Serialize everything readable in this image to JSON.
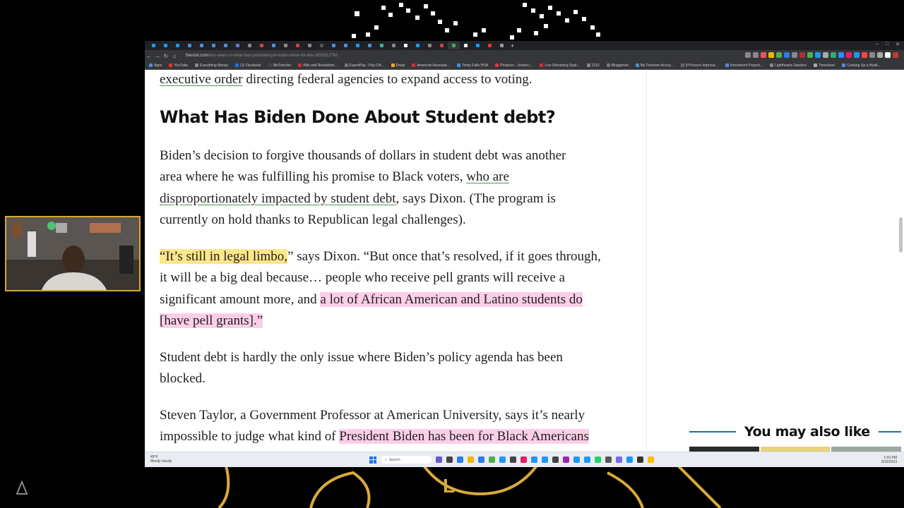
{
  "browser": {
    "tab_count": 30,
    "url_domain": "theroot.com",
    "url_path": "/two-years-in-what-has-president-joe-biden-done-for-bla-1850012763",
    "bookmarks": [
      "Apps",
      "YouTube",
      "Everything Money",
      "(2) Facebook",
      "WeTransfer",
      "Bills and Resolution...",
      "ExpertPay - Pay Chi...",
      "Emoji",
      "American Associati...",
      "Trinity Falls HOA",
      "Products - Jordan l...",
      "Live Streaming Stud...",
      "1215",
      "Bloggernel",
      "My Freedom Accou...",
      "8 Process Improve...",
      "Investment Propert...",
      "Lighthearts Sanders",
      "Timesheet",
      "Cooking Up a Healt..."
    ]
  },
  "article": {
    "intro_link": "executive order",
    "intro_rest": " directing federal agencies to expand access to voting.",
    "heading": "What Has Biden Done About Student debt?",
    "p1": {
      "line1": "Biden’s decision to forgive thousands of dollars in student debt was another",
      "line2_a": "area where he was fulfilling his promise to Black voters, ",
      "line2_link": "who are",
      "line3_link": "disproportionately impacted by student debt",
      "line3_b": ", says Dixon. (The program is",
      "line4": "currently on hold thanks to Republican legal challenges)."
    },
    "p2": {
      "line1_hl": "“It’s still in legal limbo,",
      "line1_rest": "” says Dixon. “But once that’s resolved, if it goes through,",
      "line2": "it will be a big deal because… people who receive pell grants will receive a",
      "line3_a": "significant amount more, and ",
      "line3_hl": "a lot of African American and Latino students do",
      "line4_hl": "[have pell grants].”"
    },
    "p3": {
      "line1": "Student debt is hardly the only issue where Biden’s policy agenda has been",
      "line2": "blocked."
    },
    "p4": {
      "line1": "Steven Taylor, a Government Professor at American University, says it’s nearly",
      "line2_a": "impossible to judge what kind of ",
      "line2_hl": "President Biden has been for Black Americans"
    }
  },
  "sidebar": {
    "you_may_also_like": "You may also like"
  },
  "taskbar": {
    "weather_temp": "45°F",
    "weather_desc": "Mostly cloudy",
    "search_label": "Search",
    "time": "1:03 PM",
    "date": "3/15/2023"
  },
  "colors": {
    "highlight_yellow": "#fde68a",
    "highlight_pink": "#fbcfe8",
    "link_underline": "#4a9b4a",
    "webcam_border": "#d6a534",
    "sidebar_rule": "#1f6fb2"
  }
}
